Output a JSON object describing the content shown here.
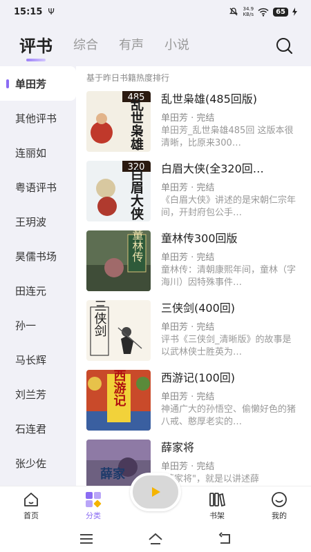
{
  "status_bar": {
    "time": "15:15",
    "usb_icon": "usb-icon",
    "net_speed_value": "34.9",
    "net_speed_unit": "KB/s",
    "battery": "65"
  },
  "header": {
    "tabs": [
      {
        "label": "评书",
        "active": true
      },
      {
        "label": "综合"
      },
      {
        "label": "有声"
      },
      {
        "label": "小说"
      }
    ],
    "search_icon": "search-icon"
  },
  "sidebar": {
    "items": [
      {
        "label": "单田芳",
        "active": true
      },
      {
        "label": "其他评书"
      },
      {
        "label": "连丽如"
      },
      {
        "label": "粤语评书"
      },
      {
        "label": "王玥波"
      },
      {
        "label": "昊儒书场"
      },
      {
        "label": "田连元"
      },
      {
        "label": "孙一"
      },
      {
        "label": "马长辉"
      },
      {
        "label": "刘兰芳"
      },
      {
        "label": "石连君"
      },
      {
        "label": "张少佐"
      }
    ]
  },
  "content": {
    "rank_note": "基于昨日书籍热度排行",
    "books": [
      {
        "title": "乱世枭雄(485回版)",
        "meta": "单田芳 · 完结",
        "desc": "单田芳_乱世枭雄485回 这版本很清晰，比原来300…",
        "cover_text": "乱世枭雄",
        "cover_badge": "485"
      },
      {
        "title": "白眉大侠(全320回…",
        "meta": "单田芳 · 完结",
        "desc": "《白眉大侠》讲述的是宋朝仁宗年间，开封府包公手…",
        "cover_text": "白眉大侠",
        "cover_badge": "320"
      },
      {
        "title": "童林传300回版",
        "meta": "单田芳 · 完结",
        "desc": "童林传：清朝康熙年间，童林（字海川）因特殊事件…",
        "cover_text": "童林传"
      },
      {
        "title": "三侠剑(400回)",
        "meta": "单田芳 · 完结",
        "desc": "评书《三侠剑_清晰版》的故事是以武林侠士胜英为…",
        "cover_text": "三侠剑"
      },
      {
        "title": "西游记(100回)",
        "meta": "单田芳 · 完结",
        "desc": "神通广大的孙悟空、偷懒好色的猪八戒、憨厚老实的…",
        "cover_text": "西游记"
      },
      {
        "title": "薛家将",
        "meta": "单田芳 · 完结",
        "desc": "\"薛家将\"，就是以讲述薛",
        "cover_text": "薛家"
      }
    ]
  },
  "bottom_nav": {
    "items": [
      {
        "label": "首页",
        "icon": "home-icon"
      },
      {
        "label": "分类",
        "icon": "category-icon",
        "active": true
      },
      {
        "label": "书架",
        "icon": "bookshelf-icon"
      },
      {
        "label": "我的",
        "icon": "profile-icon"
      }
    ],
    "play_icon": "play-icon"
  },
  "system_nav": {
    "menu_icon": "menu-icon",
    "home_icon": "home-icon",
    "back_icon": "back-icon"
  },
  "colors": {
    "accent": "#8b6cf3",
    "background": "#f1f1f7",
    "play_triangle": "#f5b400"
  }
}
